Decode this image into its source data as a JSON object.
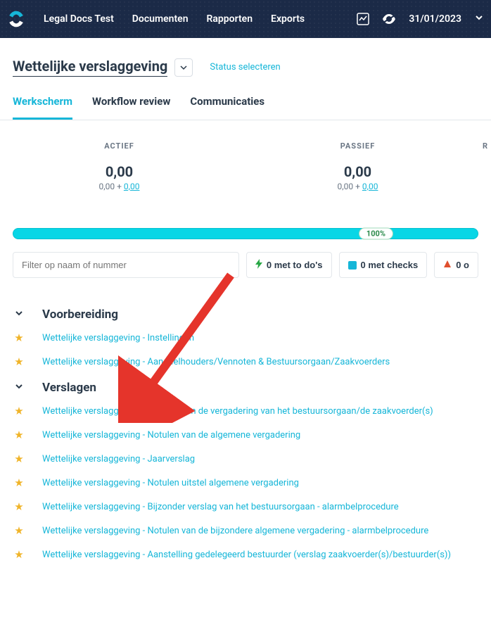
{
  "topbar": {
    "nav": [
      "Legal Docs Test",
      "Documenten",
      "Rapporten",
      "Exports"
    ],
    "date": "31/01/2023"
  },
  "header": {
    "title": "Wettelijke verslaggeving",
    "status_link": "Status selecteren"
  },
  "tabs": [
    {
      "label": "Werkscherm",
      "active": true
    },
    {
      "label": "Workflow review",
      "active": false
    },
    {
      "label": "Communicaties",
      "active": false
    }
  ],
  "stats": {
    "actief": {
      "label": "ACTIEF",
      "value": "0,00",
      "sub_plain": "0,00 + ",
      "sub_link": "0,00"
    },
    "passief": {
      "label": "PASSIEF",
      "value": "0,00",
      "sub_plain": "0,00 + ",
      "sub_link": "0,00"
    },
    "r": {
      "label": "R"
    }
  },
  "progress": {
    "pct_label": "100%"
  },
  "filter": {
    "placeholder": "Filter op naam of nummer",
    "todos": "0 met to do's",
    "checks": "0 met checks",
    "other": "0 o"
  },
  "sections": [
    {
      "title": "Voorbereiding",
      "items": [
        "Wettelijke verslaggeving - Instellingen",
        "Wettelijke verslaggeving - Aandeelhouders/Vennoten & Bestuursorgaan/Zaakvoerders"
      ]
    },
    {
      "title": "Verslagen",
      "items": [
        "Wettelijke verslaggeving - Notulen van de vergadering van het bestuursorgaan/de zaakvoerder(s)",
        "Wettelijke verslaggeving - Notulen van de algemene vergadering",
        "Wettelijke verslaggeving - Jaarverslag",
        "Wettelijke verslaggeving - Notulen uitstel algemene vergadering",
        "Wettelijke verslaggeving - Bijzonder verslag van het bestuursorgaan - alarmbelprocedure",
        "Wettelijke verslaggeving - Notulen van de bijzondere algemene vergadering - alarmbelprocedure",
        "Wettelijke verslaggeving - Aanstelling gedelegeerd bestuurder (verslag zaakvoerder(s)/bestuurder(s))"
      ]
    }
  ]
}
